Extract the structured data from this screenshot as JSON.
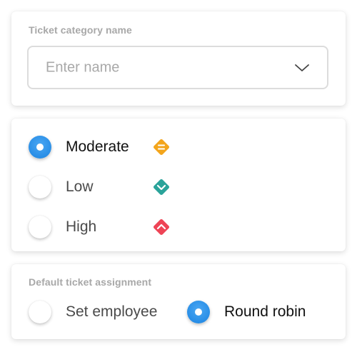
{
  "category": {
    "label": "Ticket category name",
    "placeholder": "Enter name"
  },
  "priority": {
    "options": [
      {
        "label": "Moderate",
        "selected": true,
        "icon": "equal-diamond-icon",
        "color": "#f3a51c"
      },
      {
        "label": "Low",
        "selected": false,
        "icon": "chevron-down-diamond-icon",
        "color": "#2aa39a"
      },
      {
        "label": "High",
        "selected": false,
        "icon": "chevron-up-diamond-icon",
        "color": "#ee4456"
      }
    ]
  },
  "assignment": {
    "label": "Default ticket assignment",
    "options": [
      {
        "label": "Set employee",
        "selected": false
      },
      {
        "label": "Round robin",
        "selected": true
      }
    ]
  },
  "colors": {
    "accent": "#1a83e1"
  }
}
